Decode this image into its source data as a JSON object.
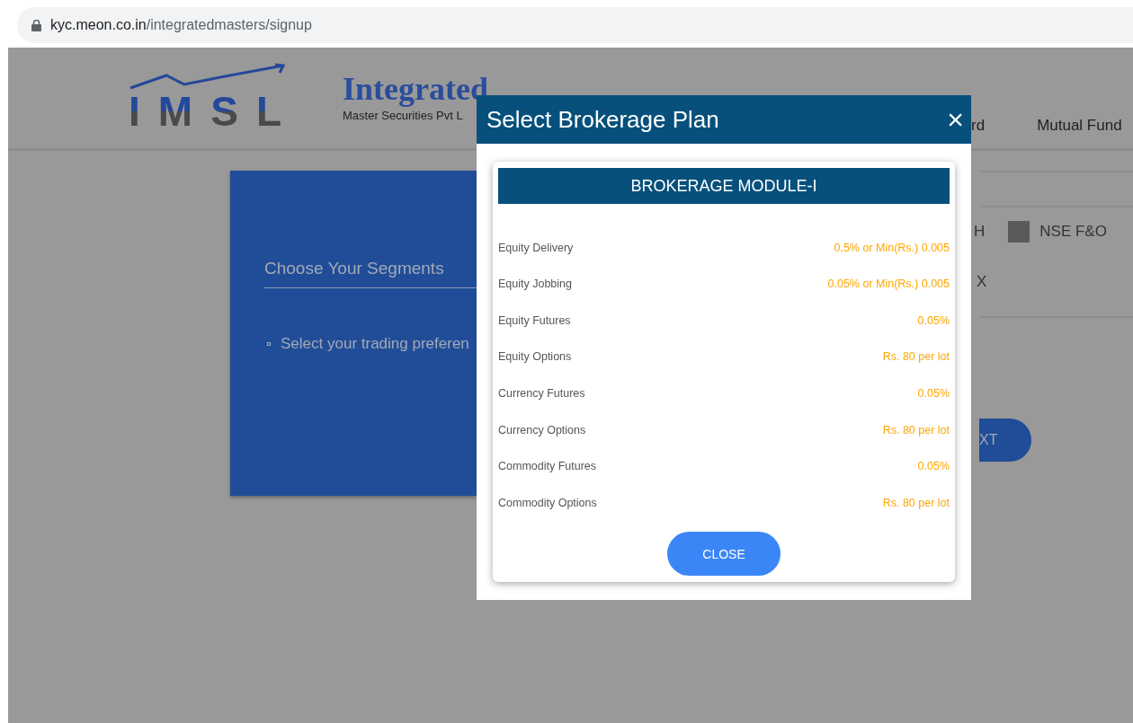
{
  "browser": {
    "url_host": "kyc.meon.co.in",
    "url_path": "/integratedmasters/signup"
  },
  "header": {
    "logo_text": "IMSL",
    "brand_title": "Integrated",
    "brand_subtitle": "Master Securities Pvt L",
    "nav": [
      "rd",
      "Mutual Fund"
    ]
  },
  "segments_card": {
    "title": "Choose Your Segments",
    "bullets": [
      "Select your trading preferen"
    ]
  },
  "segment_panel": {
    "options": [
      {
        "label": "H",
        "kind": "text"
      },
      {
        "label": "NSE F&O",
        "checked": false,
        "kind": "checkbox"
      },
      {
        "label": "X",
        "kind": "text"
      }
    ],
    "next_button": "XT"
  },
  "modal": {
    "title": "Select Brokerage Plan",
    "close_icon": "×",
    "plan_title": "BROKERAGE MODULE-I",
    "rows": [
      {
        "label": "Equity Delivery",
        "value": "0.5% or Min(Rs.) 0.005"
      },
      {
        "label": "Equity Jobbing",
        "value": "0.05% or Min(Rs.) 0.005"
      },
      {
        "label": "Equity Futures",
        "value": "0.05%"
      },
      {
        "label": "Equity Options",
        "value": "Rs. 80 per lot"
      },
      {
        "label": "Currency Futures",
        "value": "0.05%"
      },
      {
        "label": "Currency Options",
        "value": "Rs. 80 per lot"
      },
      {
        "label": "Commodity Futures",
        "value": "0.05%"
      },
      {
        "label": "Commodity Options",
        "value": "Rs. 80 per lot"
      }
    ],
    "close_button": "CLOSE"
  }
}
